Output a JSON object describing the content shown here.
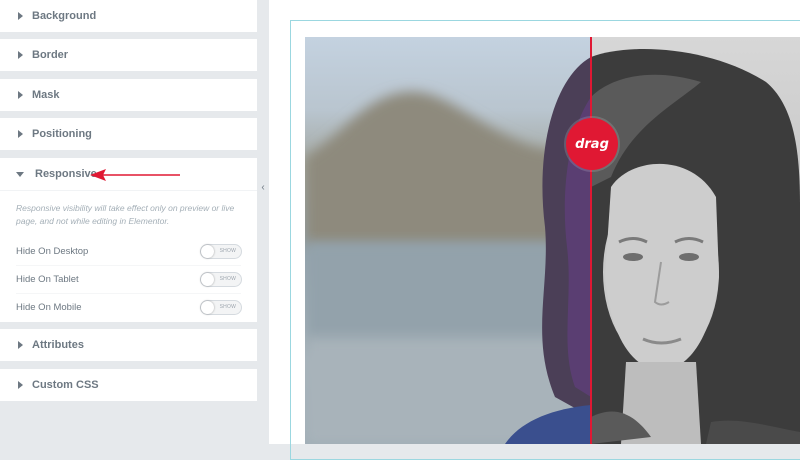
{
  "panel": {
    "sections": [
      {
        "title": "Background"
      },
      {
        "title": "Border"
      },
      {
        "title": "Mask"
      },
      {
        "title": "Positioning"
      }
    ],
    "responsive": {
      "title": "Responsive",
      "note": "Responsive visibility will take effect only on preview or live page, and not while editing in Elementor.",
      "rows": [
        {
          "label": "Hide On Desktop",
          "toggle": "SHOW"
        },
        {
          "label": "Hide On Tablet",
          "toggle": "SHOW"
        },
        {
          "label": "Hide On Mobile",
          "toggle": "SHOW"
        }
      ]
    },
    "after_sections": [
      {
        "title": "Attributes"
      },
      {
        "title": "Custom CSS"
      }
    ]
  },
  "canvas": {
    "drag_label": "drag"
  },
  "colors": {
    "accent_red": "#e01833",
    "frame_border": "#9bd7e0",
    "panel_bg": "#e6e9ec",
    "label_gray": "#6d7882"
  },
  "icons": {
    "collapse_handle": "chevron-left-icon",
    "annotation": "red-arrow-icon"
  }
}
